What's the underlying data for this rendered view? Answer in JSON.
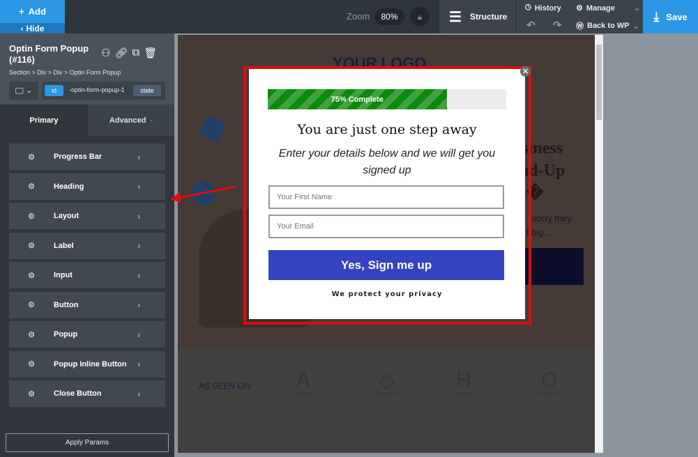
{
  "topbar": {
    "add": "Add",
    "hide": "Hide",
    "zoom_label": "Zoom",
    "zoom_value": "80%",
    "structure": "Structure",
    "history": "History",
    "manage": "Manage",
    "back_to_wp": "Back to WP",
    "save": "Save"
  },
  "panel": {
    "title": "Optin Form Popup (#116)",
    "breadcrumb": "Section > Div > Div > Optin Form Popup",
    "id_tag": "id",
    "id_value": "-optin-form-popup-1",
    "state": "state",
    "tabs": {
      "primary": "Primary",
      "advanced": "Advanced"
    },
    "items": [
      {
        "label": "Progress Bar"
      },
      {
        "label": "Heading"
      },
      {
        "label": "Layout"
      },
      {
        "label": "Label"
      },
      {
        "label": "Input"
      },
      {
        "label": "Button"
      },
      {
        "label": "Popup"
      },
      {
        "label": "Popup Inline Button"
      },
      {
        "label": "Close Button"
      }
    ],
    "apply": "Apply Params"
  },
  "page": {
    "logo": "YOUR LOGO",
    "hero_line1": "usiness",
    "hero_line2": "nd-Up",
    "hero_line3": "�",
    "body1": "worry they",
    "body2": "t big...",
    "as_seen_on": "AS SEEN ON:",
    "company": "COMPANY"
  },
  "popup": {
    "progress": 75,
    "progress_label": "75% Complete",
    "heading": "You are just one step away",
    "subheading": "Enter your details below and we will get you signed up",
    "first_name_placeholder": "Your First Name",
    "email_placeholder": "Your Email",
    "submit": "Yes, Sign me up",
    "privacy": "We protect your privacy"
  },
  "colors": {
    "accent": "#2b98e6",
    "progress": "#0b8a0b",
    "submit": "#3443c0",
    "selection": "#e00c0c"
  }
}
